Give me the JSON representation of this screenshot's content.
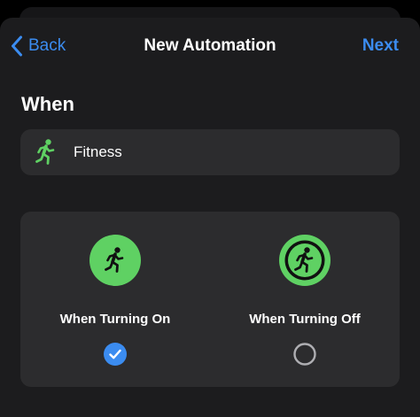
{
  "nav": {
    "back_label": "Back",
    "title": "New Automation",
    "next_label": "Next"
  },
  "section": {
    "heading": "When"
  },
  "trigger": {
    "icon": "figure-run-icon",
    "label": "Fitness"
  },
  "options": [
    {
      "label": "When Turning On",
      "icon": "figure-run-filled-circle-icon",
      "selected": true
    },
    {
      "label": "When Turning Off",
      "icon": "figure-run-outlined-circle-icon",
      "selected": false
    }
  ],
  "colors": {
    "accent": "#3b8cf0",
    "fitness_green": "#5fd163",
    "background": "#1c1c1e",
    "card": "#2c2c2e"
  }
}
